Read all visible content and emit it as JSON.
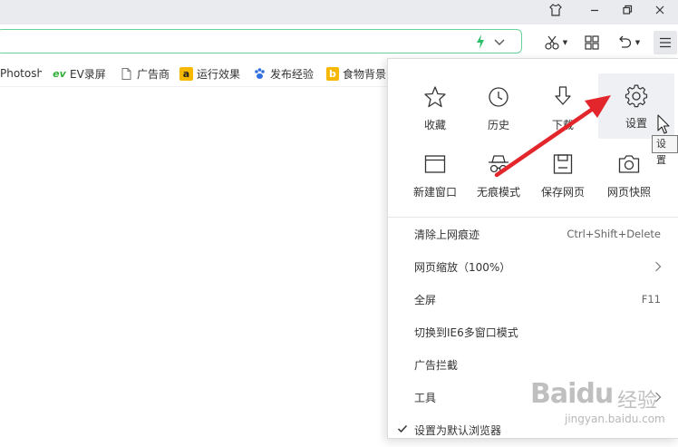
{
  "bookmarks": [
    {
      "label": "Photosh",
      "icon": "none"
    },
    {
      "label": "EV录屏",
      "icon": "ev-icon"
    },
    {
      "label": "广告商",
      "icon": "page-icon"
    },
    {
      "label": "运行效果",
      "icon": "a-icon"
    },
    {
      "label": "发布经验",
      "icon": "paw-icon"
    },
    {
      "label": "食物背景",
      "icon": "b-icon"
    }
  ],
  "menu": {
    "tiles": [
      {
        "label": "收藏",
        "icon": "star-icon"
      },
      {
        "label": "历史",
        "icon": "clock-icon"
      },
      {
        "label": "下载",
        "icon": "download-icon"
      },
      {
        "label": "设置",
        "icon": "gear-icon"
      },
      {
        "label": "新建窗口",
        "icon": "window-icon"
      },
      {
        "label": "无痕模式",
        "icon": "incognito-icon"
      },
      {
        "label": "保存网页",
        "icon": "save-icon"
      },
      {
        "label": "网页快照",
        "icon": "camera-icon"
      }
    ],
    "items": [
      {
        "label": "清除上网痕迹",
        "shortcut": "Ctrl+Shift+Delete"
      },
      {
        "label": "网页缩放（100%）",
        "shortcut": ""
      },
      {
        "label": "全屏",
        "shortcut": "F11"
      },
      {
        "label": "切换到IE6多窗口模式",
        "shortcut": ""
      },
      {
        "label": "广告拦截",
        "shortcut": ""
      },
      {
        "label": "工具",
        "shortcut": ""
      },
      {
        "label": "设置为默认浏览器",
        "shortcut": ""
      }
    ]
  },
  "tooltip": "设置",
  "watermark": {
    "logo": "Baidu",
    "cn": "经验",
    "url": "jingyan.baidu.com"
  },
  "colors": {
    "accent_green": "#67d29b",
    "arrow_red": "#e3262b",
    "titlebar": "#e9ebee"
  }
}
